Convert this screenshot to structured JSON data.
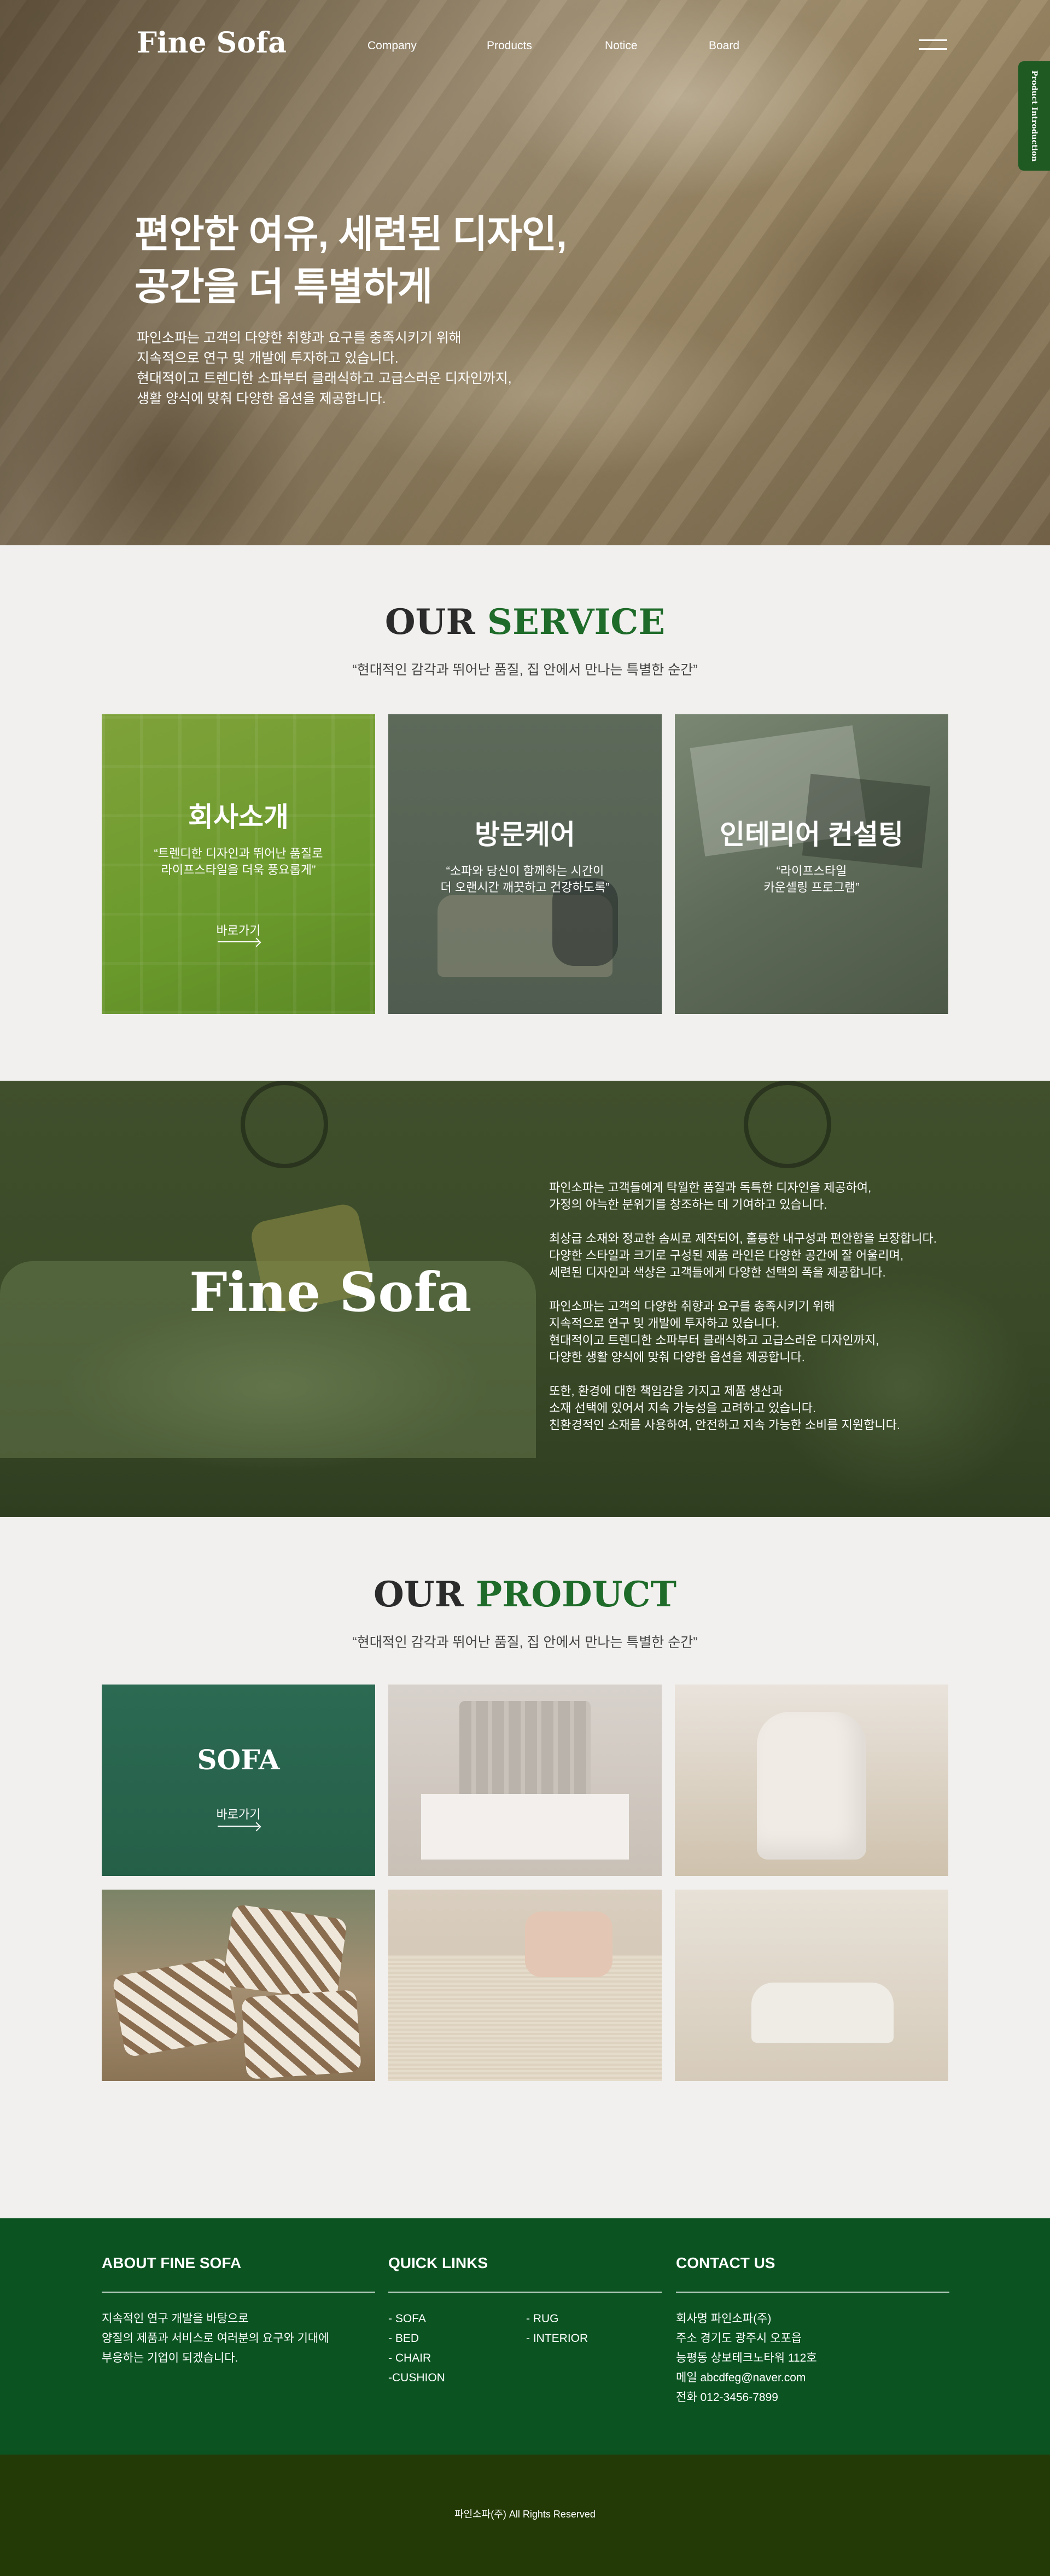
{
  "header": {
    "logo": "Fine Sofa",
    "nav": [
      "Company",
      "Products",
      "Notice",
      "Board"
    ],
    "side_tab": "Product Introduction"
  },
  "hero": {
    "title_line1": "편안한 여유, 세련된 디자인,",
    "title_line2": "공간을 더 특별하게",
    "desc": [
      "파인소파는 고객의 다양한 취향과 요구를 충족시키기 위해",
      "지속적으로 연구 및 개발에 투자하고 있습니다.",
      "현대적이고 트렌디한 소파부터 클래식하고 고급스러운 디자인까지,",
      "생활 양식에 맞춰 다양한 옵션을 제공합니다."
    ]
  },
  "service": {
    "title_a": "OUR ",
    "title_b": "SERVICE",
    "subtitle": "“현대적인 감각과 뛰어난 품질, 집 안에서 만나는 특별한 순간”",
    "cards": [
      {
        "title": "회사소개",
        "desc1": "“트렌디한 디자인과 뛰어난 품질로",
        "desc2": "라이프스타일을 더욱 풍요롭게”",
        "link": "바로가기"
      },
      {
        "title": "방문케어",
        "desc1": "“소파와 당신이 함께하는 시간이",
        "desc2": "더 오랜시간 깨끗하고 건강하도록”"
      },
      {
        "title": "인테리어 컨설팅",
        "desc1": "“라이프스타일",
        "desc2": "카운셀링 프로그램”"
      }
    ]
  },
  "banner": {
    "logo": "Fine Sofa",
    "paragraphs": [
      [
        "파인소파는 고객들에게 탁월한 품질과 독특한 디자인을 제공하여,",
        "가정의 아늑한 분위기를 창조하는 데 기여하고 있습니다."
      ],
      [
        "최상급 소재와 정교한 솜씨로 제작되어, 훌륭한 내구성과 편안함을 보장합니다.",
        "다양한 스타일과 크기로 구성된 제품 라인은 다양한 공간에 잘 어울리며,",
        "세련된 디자인과 색상은 고객들에게 다양한 선택의 폭을 제공합니다."
      ],
      [
        "파인소파는 고객의 다양한 취향과 요구를 충족시키기 위해",
        "지속적으로 연구 및 개발에 투자하고 있습니다.",
        "현대적이고 트렌디한 소파부터 클래식하고 고급스러운 디자인까지,",
        "다양한 생활 양식에 맞춰 다양한 옵션을 제공합니다."
      ],
      [
        "또한, 환경에 대한 책임감을 가지고 제품 생산과",
        "소재 선택에 있어서 지속 가능성을 고려하고 있습니다.",
        "친환경적인 소재를 사용하여, 안전하고 지속 가능한 소비를 지원합니다."
      ]
    ]
  },
  "product": {
    "title_a": "OUR ",
    "title_b": "PRODUCT",
    "subtitle": "“현대적인 감각과 뛰어난 품질, 집 안에서 만나는 특별한 순간”",
    "featured_title": "SOFA",
    "featured_link": "바로가기"
  },
  "footer": {
    "about_title": "ABOUT FINE SOFA",
    "about_lines": [
      "지속적인 연구 개발을 바탕으로",
      "양질의 제품과 서비스로 여러분의 요구와 기대에",
      "부응하는 기업이 되겠습니다."
    ],
    "links_title": "QUICK LINKS",
    "links_col1": [
      "- SOFA",
      "- BED",
      "- CHAIR",
      "-CUSHION"
    ],
    "links_col2": [
      "- RUG",
      "- INTERIOR"
    ],
    "contact_title": "CONTACT US",
    "contact_lines": [
      "회사명 파인소파(주)",
      "주소 경기도 광주시 오포읍",
      "능평동 상보테크노타워 112호",
      "메일 abcdfeg@naver.com",
      "전화 012-3456-7899"
    ],
    "copyright": "파인소파(주) All Rights Reserved"
  },
  "colors": {
    "brand_green": "#1f6b2a",
    "footer_green": "#0b5422",
    "bottom_olive": "#233a06",
    "background": "#f1f0ee"
  }
}
